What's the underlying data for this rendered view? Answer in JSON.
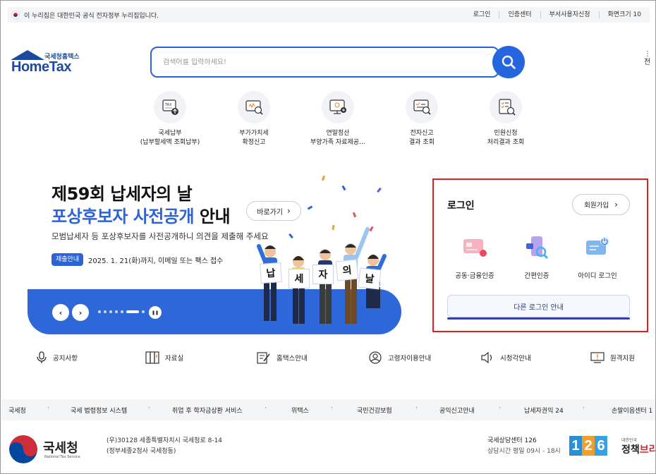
{
  "gov_bar": {
    "text": "이 누리집은 대한민국 공식 전자정부 누리집입니다.",
    "links": [
      "로그인",
      "인증센터",
      "부서사용자신청",
      "화면크기 10"
    ]
  },
  "header": {
    "logo_small": "국세청홈택스",
    "logo_big": "HomeTax",
    "search_placeholder": "검색어를 입력하세요!",
    "menu_edge_top": "⋮",
    "menu_edge_bottom": "전"
  },
  "quick_services": [
    {
      "line1": "국세납부",
      "line2": "(납부할세액 조회납부)",
      "icon": "tax-payment-icon"
    },
    {
      "line1": "부가가치세",
      "line2": "확정신고",
      "icon": "vat-report-icon"
    },
    {
      "line1": "연말정산",
      "line2": "부양가족 자료제공…",
      "icon": "year-end-settlement-icon"
    },
    {
      "line1": "전자신고",
      "line2": "결과 조회",
      "icon": "e-filing-result-icon"
    },
    {
      "line1": "민원신청",
      "line2": "처리결과 조회",
      "icon": "civil-petition-icon"
    }
  ],
  "banner": {
    "title_line1": "제59회 납세자의 날",
    "title_line2_blue": "포상후보자 사전공개",
    "title_line2_rest": " 안내",
    "go_label": "바로가기",
    "subtitle": "모범납세자 등 포상후보자를 사전공개하니 의견을 제출해 주세요",
    "badge": "제출안내",
    "badge_text": "2025. 1. 21(화)까지, 이메일 또는 팩스 접수",
    "signs": [
      "납",
      "세",
      "자",
      "의",
      "날"
    ],
    "prev": "‹",
    "next": "›",
    "pause": "❚❚"
  },
  "login": {
    "title": "로그인",
    "join_label": "회원가입",
    "options": [
      "공동·금융인증",
      "간편인증",
      "아이디 로그인"
    ],
    "other_label": "다른 로그인 안내"
  },
  "quick_menu": [
    "공지사항",
    "자료실",
    "홈택스안내",
    "고령자이용안내",
    "시청각안내",
    "원격지원"
  ],
  "links_bar": [
    "국세청",
    "국세 법령정보 시스템",
    "취업 후 학자금상환 서비스",
    "위택스",
    "국민건강보험",
    "공익신고안내",
    "납세자권익 24",
    "손말이음센터 1"
  ],
  "footer": {
    "brand": "국세청",
    "brand_sub": "National Tax Service",
    "address_line1": "(우)30128 세종특별자치시 국세청로 8-14",
    "address_line2": "(정부세종2청사 국세청동)",
    "center_title": "국세상담센터 126",
    "center_hours": "상담시간 평일 09시 - 18시",
    "digits": [
      "1",
      "2",
      "6"
    ],
    "policy_small": "대한민국",
    "policy_black": "정책",
    "policy_red": "브리"
  },
  "colors": {
    "primary_blue": "#2565dd",
    "highlight_red": "#e0201f",
    "logo_navy": "#1d4a9e"
  }
}
